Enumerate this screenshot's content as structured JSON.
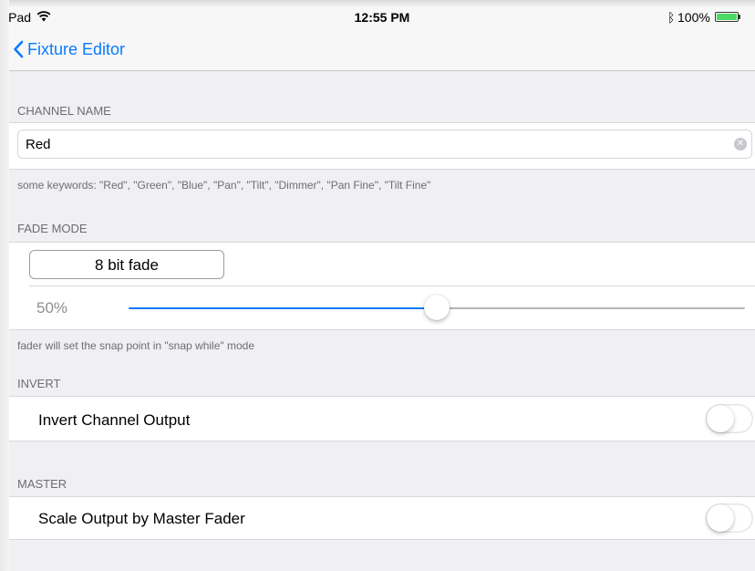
{
  "status_bar": {
    "device": "iPad",
    "time": "12:55 PM",
    "battery": "100%"
  },
  "nav": {
    "back_label": "Fixture Editor"
  },
  "channel_name": {
    "header": "CHANNEL NAME",
    "value": "Red",
    "footer": "some keywords: \"Red\", \"Green\", \"Blue\", \"Pan\", \"Tilt\", \"Dimmer\", \"Pan Fine\", \"Tilt Fine\""
  },
  "fade_mode": {
    "header": "FADE MODE",
    "button_label": "8 bit fade",
    "slider_label": "50%",
    "slider_value": 0.5,
    "footer": "fader will set the snap point in \"snap while\" mode"
  },
  "invert": {
    "header": "INVERT",
    "label": "Invert Channel Output",
    "on": false
  },
  "master": {
    "header": "MASTER",
    "label": "Scale Output by Master Fader",
    "on": false
  },
  "colors": {
    "accent": "#0a7aff",
    "battery": "#4cd964",
    "grouped_background": "#efeff4"
  },
  "icons": {
    "back": "chevron-left-icon",
    "wifi": "wifi-icon",
    "bluetooth": "bluetooth-icon",
    "battery": "battery-icon",
    "clear": "clear-icon"
  }
}
